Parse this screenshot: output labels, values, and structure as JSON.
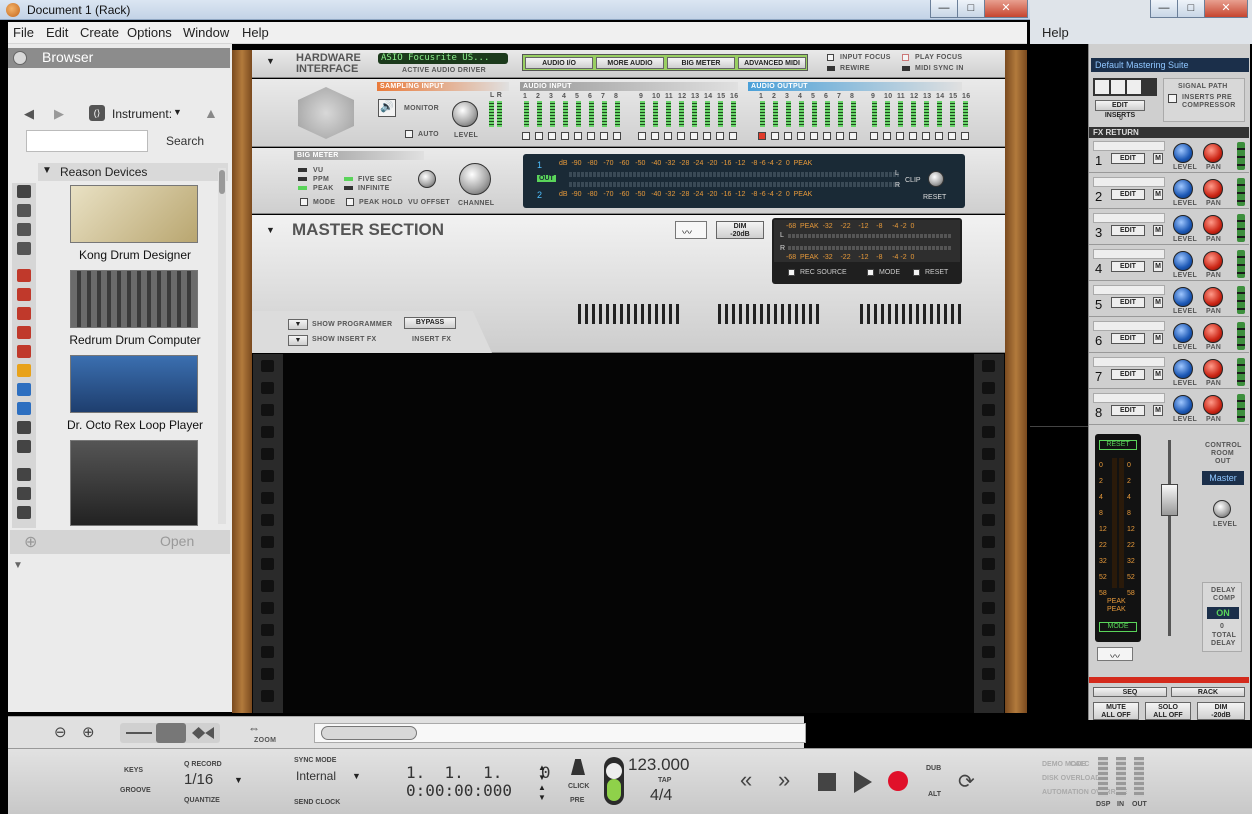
{
  "window": {
    "title": "Document 1 (Rack)",
    "min": "—",
    "max": "□",
    "close": "✕"
  },
  "menu": [
    "File",
    "Edit",
    "Create",
    "Options",
    "Window",
    "Help"
  ],
  "right_window": {
    "help": "Help",
    "min": "—",
    "max": "□",
    "close": "✕"
  },
  "browser": {
    "title": "Browser",
    "location": "Instrument:",
    "search_label": "Search",
    "search_placeholder": "",
    "folder": "Reason Devices",
    "devices": [
      "Kong Drum Designer",
      "Redrum Drum Computer",
      "Dr. Octo Rex Loop Player"
    ],
    "open_label": "Open"
  },
  "hardware": {
    "title_1": "HARDWARE",
    "title_2": "INTERFACE",
    "driver_name": "ASIO Focusrite US...",
    "driver_label": "ACTIVE AUDIO DRIVER",
    "tabs": [
      "AUDIO I/O",
      "MORE AUDIO",
      "BIG METER",
      "ADVANCED MIDI"
    ],
    "input_focus": "INPUT FOCUS",
    "play_focus": "PLAY FOCUS",
    "rewire": "REWIRE",
    "midi_sync": "MIDI SYNC IN",
    "sampling_input": "SAMPLING INPUT",
    "monitor": "MONITOR",
    "auto": "AUTO",
    "level": "LEVEL",
    "audio_input": "AUDIO INPUT",
    "audio_output": "AUDIO OUTPUT",
    "lr": "L  R",
    "channels": [
      "1",
      "2",
      "3",
      "4",
      "5",
      "6",
      "7",
      "8",
      "9",
      "10",
      "11",
      "12",
      "13",
      "14",
      "15",
      "16"
    ]
  },
  "big_meter": {
    "title": "BIG METER",
    "modes": [
      "VU",
      "PPM",
      "PEAK"
    ],
    "holds": [
      "FIVE SEC",
      "INFINITE"
    ],
    "mode": "MODE",
    "peak_hold": "PEAK HOLD",
    "vu_offset": "VU OFFSET",
    "channel": "CHANNEL",
    "scale": "dB  -90   -80   -70   -60   -50   -40  -32  -28  -24  -20  -16  -12   -8 -6 -4 -2  0  PEAK",
    "row1": "1",
    "row2": "2",
    "out": "OUT",
    "l": "L",
    "r": "R",
    "clip": "CLIP",
    "reset": "RESET"
  },
  "master": {
    "title": "MASTER SECTION",
    "dim": "DIM",
    "dim_value": "-20dB",
    "meter_scale": "-68  PEAK  -32    -22    -12    -8     -4 -2  0",
    "rec_source": "REC SOURCE",
    "mode": "MODE",
    "reset": "RESET",
    "show_programmer": "SHOW PROGRAMMER",
    "show_insert_fx": "SHOW INSERT FX",
    "bypass": "BYPASS",
    "insert_fx": "INSERT FX",
    "l": "L",
    "r": "R"
  },
  "mixer": {
    "preset": "Default Mastering Suite",
    "edit_inserts": "EDIT INSERTS",
    "inserts_count": "0",
    "signal_path": "SIGNAL PATH",
    "inserts_pre": "INSERTS PRE",
    "compressor": "COMPRESSOR",
    "fx_return": "FX RETURN",
    "rows": [
      {
        "num": "1",
        "edit": "EDIT",
        "m": "M",
        "level": "LEVEL",
        "pan": "PAN"
      },
      {
        "num": "2",
        "edit": "EDIT",
        "m": "M",
        "level": "LEVEL",
        "pan": "PAN"
      },
      {
        "num": "3",
        "edit": "EDIT",
        "m": "M",
        "level": "LEVEL",
        "pan": "PAN"
      },
      {
        "num": "4",
        "edit": "EDIT",
        "m": "M",
        "level": "LEVEL",
        "pan": "PAN"
      },
      {
        "num": "5",
        "edit": "EDIT",
        "m": "M",
        "level": "LEVEL",
        "pan": "PAN"
      },
      {
        "num": "6",
        "edit": "EDIT",
        "m": "M",
        "level": "LEVEL",
        "pan": "PAN"
      },
      {
        "num": "7",
        "edit": "EDIT",
        "m": "M",
        "level": "LEVEL",
        "pan": "PAN"
      },
      {
        "num": "8",
        "edit": "EDIT",
        "m": "M",
        "level": "LEVEL",
        "pan": "PAN"
      }
    ],
    "meter_reset": "RESET",
    "meter_scale": [
      "0",
      "2",
      "4",
      "8",
      "12",
      "22",
      "32",
      "52",
      "58"
    ],
    "peak": "PEAK",
    "meter_mode": "MODE",
    "control_room": "CONTROL",
    "room": "ROOM",
    "out": "OUT",
    "cr_select": "Master",
    "cr_level": "LEVEL",
    "delay_comp": "DELAY",
    "comp": "COMP",
    "on": "ON",
    "total_delay_value": "0",
    "total": "TOTAL",
    "delay": "DELAY",
    "seq": "SEQ",
    "rack": "RACK",
    "mute_all": "MUTE",
    "all_off_1": "ALL OFF",
    "solo_all": "SOLO",
    "all_off_2": "ALL OFF",
    "dim": "DIM",
    "dim_value": "-20dB"
  },
  "seqbar": {
    "zoom": "ZOOM"
  },
  "transport": {
    "keys": "KEYS",
    "groove": "GROOVE",
    "q_record": "Q RECORD",
    "quantize_value": "1/16",
    "quantize": "QUANTIZE",
    "sync_mode": "SYNC MODE",
    "sync_value": "Internal",
    "send_clock": "SEND CLOCK",
    "position": "1.  1.  1.    0",
    "time": "0:00:00:000",
    "click": "CLICK",
    "pre": "PRE",
    "tempo": "123.000",
    "tap": "TAP",
    "signature": "4/4",
    "dub": "DUB",
    "alt": "ALT",
    "demo_mode": "DEMO MODE",
    "disk_overload": "DISK OVERLOAD",
    "automation_override": "AUTOMATION OVERRIDE",
    "calc": "CALC",
    "dsp": "DSP",
    "in": "IN",
    "out": "OUT"
  }
}
